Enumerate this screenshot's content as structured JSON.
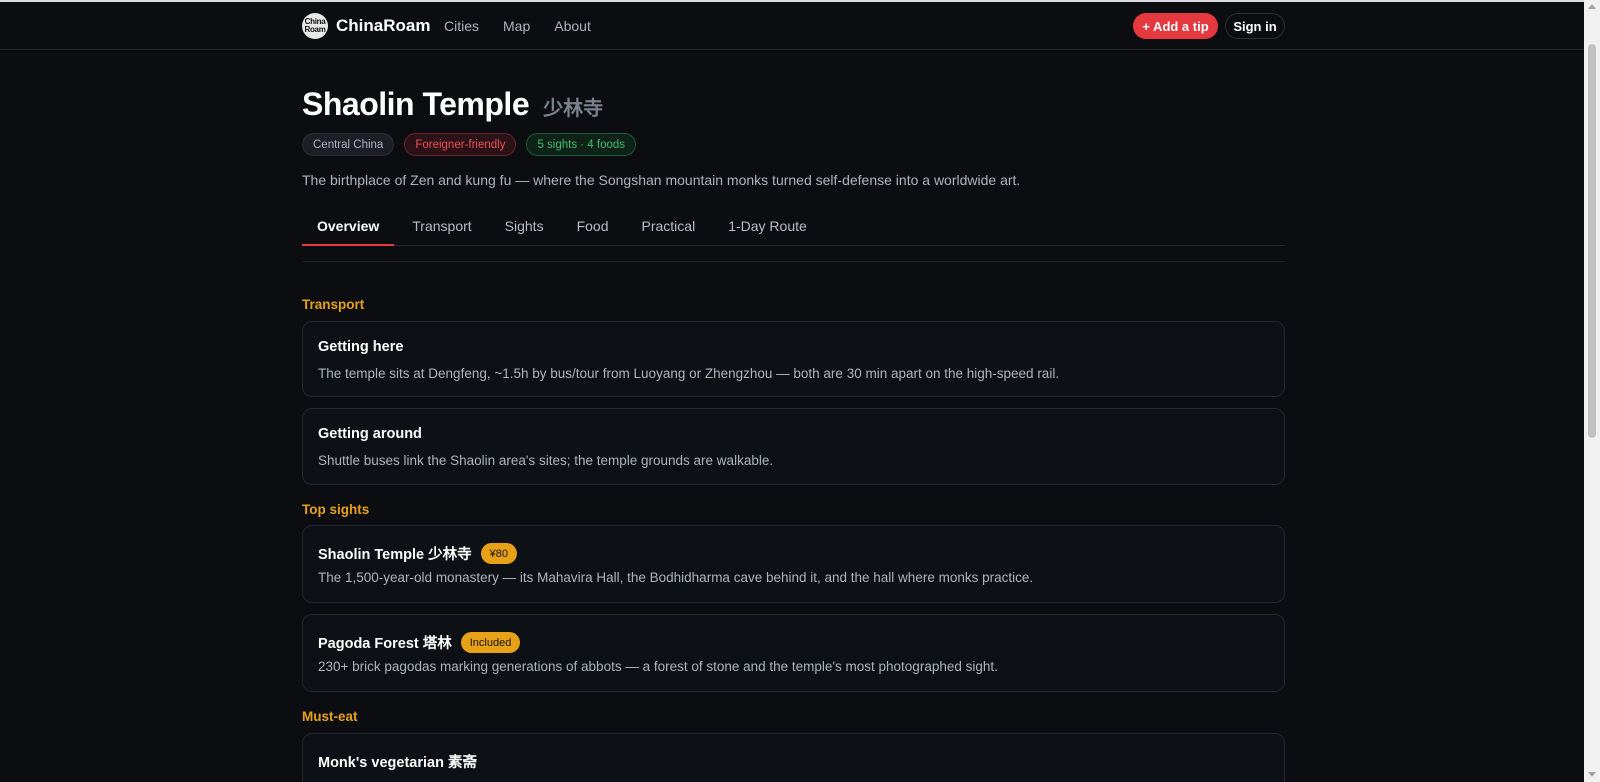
{
  "app": {
    "brand": "ChinaRoam",
    "logo_text": "China Roam"
  },
  "nav": {
    "items": [
      "Cities",
      "Map",
      "About"
    ]
  },
  "header_actions": {
    "add_tip": "+ Add a tip",
    "sign_in": "Sign in"
  },
  "page": {
    "title": "Shaolin Temple",
    "title_cn": "少林寺",
    "tags": {
      "region": "Central China",
      "friendly": "Foreigner-friendly",
      "count": "5 sights · 4 foods"
    },
    "description": "The birthplace of Zen and kung fu — where the Songshan mountain monks turned self-defense into a worldwide art.",
    "tabs": [
      "Overview",
      "Transport",
      "Sights",
      "Food",
      "Practical",
      "1-Day Route"
    ],
    "active_tab": "Overview"
  },
  "sections": {
    "transport": {
      "heading": "Transport",
      "cards": [
        {
          "title": "Getting here",
          "body": "The temple sits at Dengfeng, ~1.5h by bus/tour from Luoyang or Zhengzhou — both are 30 min apart on the high-speed rail."
        },
        {
          "title": "Getting around",
          "body": "Shuttle buses link the Shaolin area's sites; the temple grounds are walkable."
        }
      ]
    },
    "sights": {
      "heading": "Top sights",
      "cards": [
        {
          "title": "Shaolin Temple 少林寺",
          "price": "¥80",
          "body": "The 1,500-year-old monastery — its Mahavira Hall, the Bodhidharma cave behind it, and the hall where monks practice."
        },
        {
          "title": "Pagoda Forest 塔林",
          "price": "Included",
          "body": "230+ brick pagodas marking generations of abbots — a forest of stone and the temple's most photographed sight."
        }
      ]
    },
    "food": {
      "heading": "Must-eat",
      "cards": [
        {
          "title": "Monk's vegetarian 素斋"
        }
      ]
    }
  },
  "colors": {
    "accent_red": "#e5393f",
    "section_orange": "#e6a117",
    "tag_green": "#3fbd6f",
    "background": "#0b0d11"
  }
}
